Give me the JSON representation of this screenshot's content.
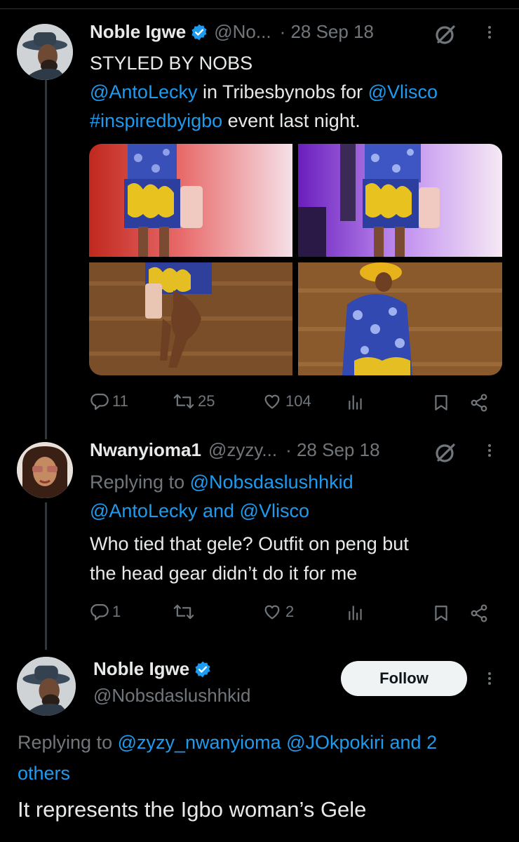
{
  "tweet1": {
    "name": "Noble Igwe",
    "handle": "@No...",
    "date": "· 28 Sep 18",
    "line1": "STYLED BY NOBS",
    "mention1": "@AntoLecky",
    "mid": " in Tribesbynobs for ",
    "mention2": "@Vlisco",
    "hashtag": "#inspiredbyigbo",
    "tail": " event last night.",
    "replies": "11",
    "retweets": "25",
    "likes": "104"
  },
  "tweet2": {
    "name": "Nwanyioma1",
    "handle": "@zyzy...",
    "date": "· 28 Sep 18",
    "replying_prefix": "Replying to ",
    "reply_to_1": "@Nobsdaslushhkid",
    "reply_to_2": "@AntoLecky and @Vlisco",
    "body_line1": "Who tied that gele? Outfit on peng but",
    "body_line2": "the head gear didn’t do it for me",
    "replies": "1",
    "likes": "2"
  },
  "tweet3": {
    "name": "Noble Igwe",
    "handle": "@Nobsdaslushhkid",
    "follow_label": "Follow",
    "replying_prefix": "Replying to ",
    "reply_to": "@zyzy_nwanyioma @JOkpokiri and 2",
    "reply_to_tail": "others",
    "body": "It represents the Igbo woman’s Gele"
  },
  "colors": {
    "background": "#000000",
    "text": "#e7e9ea",
    "secondary": "#71767b",
    "link": "#1d9bf0",
    "verified": "#1d9bf0",
    "follow_bg": "#eff3f4"
  },
  "icons": [
    "verified-badge-icon",
    "grok-icon",
    "more-icon",
    "reply-icon",
    "retweet-icon",
    "like-icon",
    "views-icon",
    "bookmark-icon",
    "share-icon"
  ]
}
